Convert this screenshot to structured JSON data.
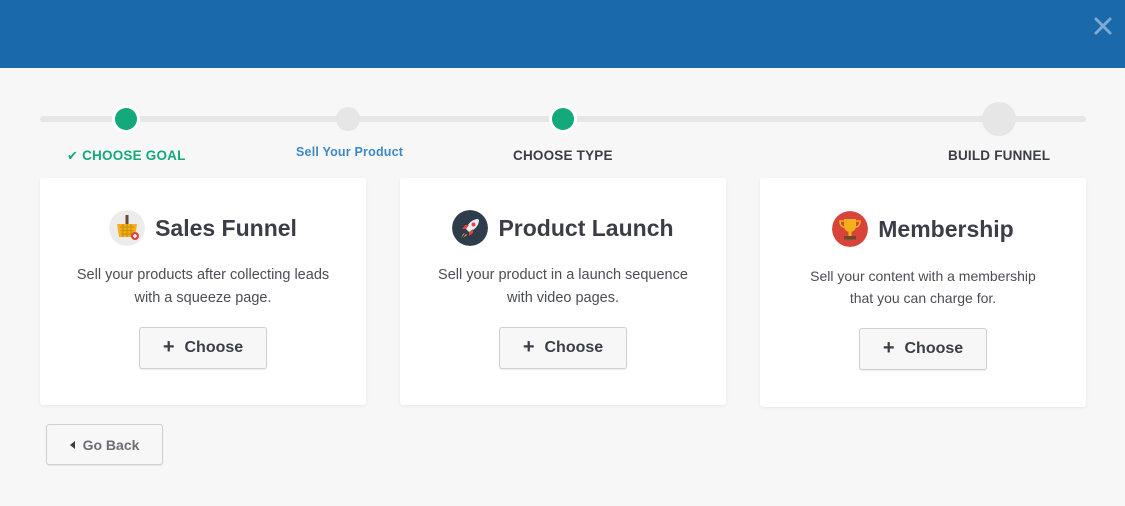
{
  "header": {
    "close_icon": "close-icon",
    "bar_color": "#1a6aab"
  },
  "progress": {
    "steps": [
      {
        "label": "CHOOSE GOAL",
        "state": "done",
        "icon": "check-icon"
      },
      {
        "label": "Sell Your Product",
        "state": "sub"
      },
      {
        "label": "CHOOSE TYPE",
        "state": "current"
      },
      {
        "label": "BUILD FUNNEL",
        "state": "pending"
      }
    ],
    "accent": "#14a97a",
    "sub_color": "#3e89c4"
  },
  "cards": [
    {
      "icon": "shopping-basket-icon",
      "title": "Sales Funnel",
      "desc_line1": "Sell your products after collecting leads",
      "desc_line2": "with a squeeze page.",
      "button": "Choose"
    },
    {
      "icon": "rocket-icon",
      "title": "Product Launch",
      "desc_line1": "Sell your product in a launch sequence",
      "desc_line2": "with video pages.",
      "button": "Choose"
    },
    {
      "icon": "trophy-icon",
      "title": "Membership",
      "desc_line1": "Sell your content with a membership",
      "desc_line2": "that you can charge for.",
      "button": "Choose"
    }
  ],
  "back": {
    "label": "Go Back",
    "icon": "caret-left-icon"
  }
}
